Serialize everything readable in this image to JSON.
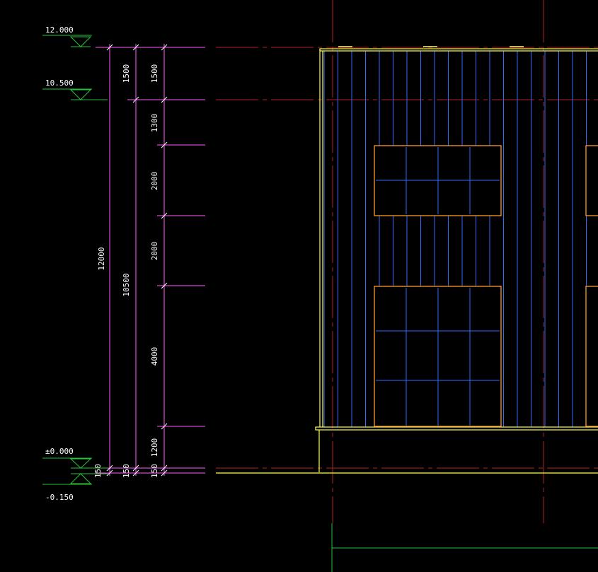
{
  "colors": {
    "background": "#000000",
    "dimension": "#ff5bff",
    "level": "#27c23a",
    "text": "#ffffff",
    "facade": "#ffff4d",
    "window_frame": "#ff9b2a",
    "panel_line": "#2f6dff",
    "axis": "#b22222"
  },
  "levels": [
    {
      "label": "12.000"
    },
    {
      "label": "10.500"
    },
    {
      "label": "±0.000"
    },
    {
      "label": "-0.150"
    }
  ],
  "dimensions": {
    "overall": "12000",
    "main": [
      "150",
      "10500",
      "1500"
    ],
    "details": [
      "150",
      "1200",
      "4000",
      "2000",
      "2000",
      "1300",
      "1500"
    ]
  }
}
